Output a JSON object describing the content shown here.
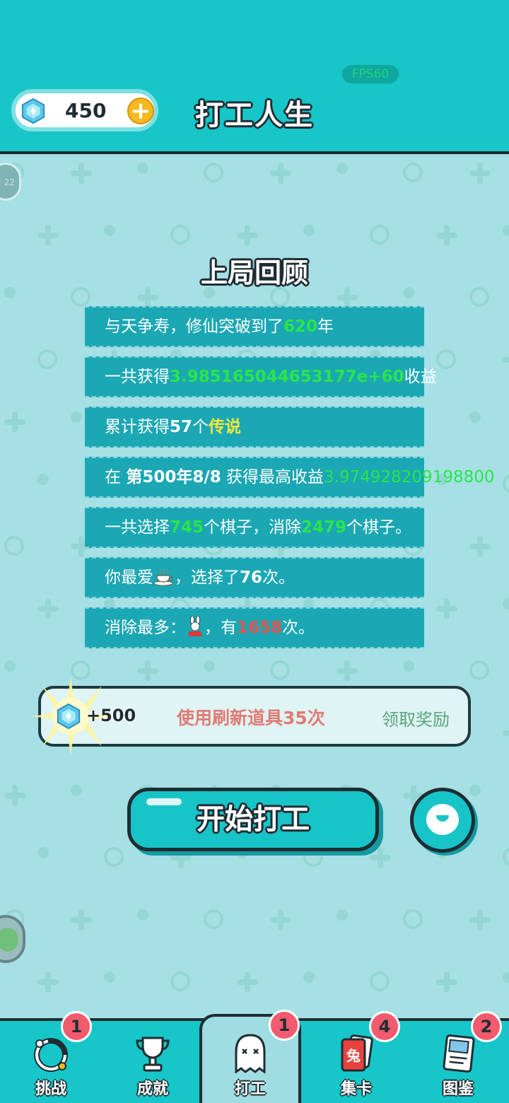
{
  "header": {
    "fps": "FPS60",
    "gem_count": "450",
    "title": "打工人生"
  },
  "side": {
    "top_button_text": "22"
  },
  "review": {
    "title": "上局回顾",
    "rows": [
      {
        "pre": "与天争寿，修仙突破到了",
        "hl": "620",
        "post": "年"
      },
      {
        "pre": "一共获得",
        "hl": "3.985165044653177e+60",
        "post": "收益"
      },
      {
        "pre": "累计获得",
        "bold": "57",
        "mid": "个",
        "hl": "传说"
      },
      {
        "pre": "在 ",
        "bold": "第500年8/8",
        "mid": " 获得最高收益",
        "hl": "3.974928209198800"
      },
      {
        "pre": "一共选择",
        "hl": "745",
        "mid": "个棋子，消除",
        "hl2": "2479",
        "post": "个棋子。"
      },
      {
        "pre": "你最爱",
        "icon": "teacup-icon",
        "mid": "，选择了",
        "bold": "76",
        "post": "次。"
      },
      {
        "pre": "消除最多：",
        "icon": "rabbit-icon",
        "mid": "，有",
        "hl": "1658",
        "post": "次。"
      }
    ]
  },
  "reward": {
    "amount": "+500",
    "task": "使用刷新道具35次",
    "claim_label": "领取奖励"
  },
  "start_label": "开始打工",
  "nav": {
    "items": [
      {
        "label": "挑战",
        "badge": "1",
        "icon": "challenge-icon"
      },
      {
        "label": "成就",
        "badge": "",
        "icon": "trophy-icon"
      },
      {
        "label": "打工",
        "badge": "1",
        "icon": "ghost-icon"
      },
      {
        "label": "集卡",
        "badge": "4",
        "icon": "card-icon",
        "card_text": "兔"
      },
      {
        "label": "图鉴",
        "badge": "2",
        "icon": "book-icon"
      }
    ]
  },
  "colors": {
    "primary": "#16c6c8",
    "highlight_green": "#29e64a",
    "highlight_yellow": "#f7e83b",
    "highlight_red": "#e6534f",
    "badge": "#f25b6e"
  }
}
